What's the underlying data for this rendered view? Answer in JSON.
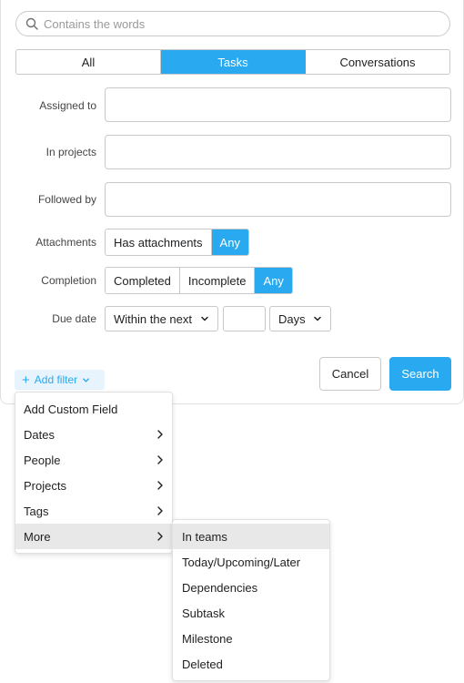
{
  "search": {
    "placeholder": "Contains the words"
  },
  "tabs": [
    {
      "label": "All",
      "active": false
    },
    {
      "label": "Tasks",
      "active": true
    },
    {
      "label": "Conversations",
      "active": false
    }
  ],
  "fields": {
    "assigned_to": {
      "label": "Assigned to",
      "value": ""
    },
    "in_projects": {
      "label": "In projects",
      "value": ""
    },
    "followed_by": {
      "label": "Followed by",
      "value": ""
    }
  },
  "attachments": {
    "label": "Attachments",
    "options": [
      "Has attachments",
      "Any"
    ],
    "selected": "Any"
  },
  "completion": {
    "label": "Completion",
    "options": [
      "Completed",
      "Incomplete",
      "Any"
    ],
    "selected": "Any"
  },
  "due_date": {
    "label": "Due date",
    "range_select": "Within the next",
    "amount": "",
    "unit_select": "Days"
  },
  "buttons": {
    "cancel": "Cancel",
    "search": "Search"
  },
  "add_filter": {
    "label": "Add filter",
    "icon": "plus-icon"
  },
  "filter_menu": [
    {
      "label": "Add Custom Field",
      "submenu": false
    },
    {
      "label": "Dates",
      "submenu": true
    },
    {
      "label": "People",
      "submenu": true
    },
    {
      "label": "Projects",
      "submenu": true
    },
    {
      "label": "Tags",
      "submenu": true
    },
    {
      "label": "More",
      "submenu": true,
      "highlighted": true
    }
  ],
  "more_submenu": [
    {
      "label": "In teams",
      "highlighted": true
    },
    {
      "label": "Today/Upcoming/Later"
    },
    {
      "label": "Dependencies"
    },
    {
      "label": "Subtask"
    },
    {
      "label": "Milestone"
    },
    {
      "label": "Deleted"
    }
  ],
  "colors": {
    "accent": "#29a9f0",
    "hover": "#e8e8e8",
    "border": "#c9c9c9"
  }
}
